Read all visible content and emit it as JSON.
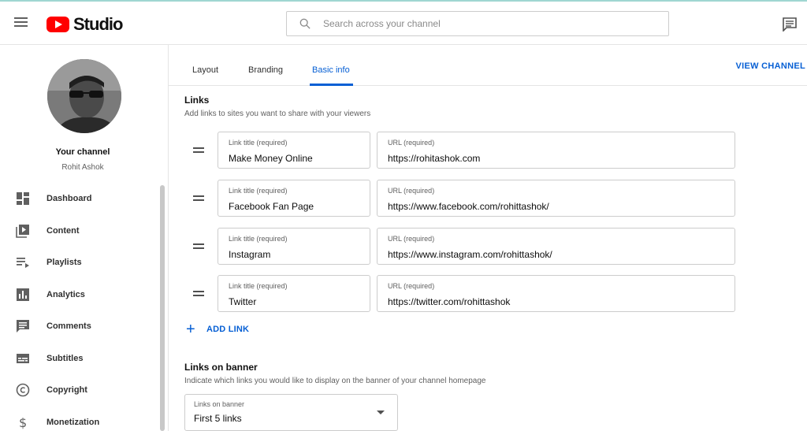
{
  "header": {
    "logo_text": "Studio",
    "search_placeholder": "Search across your channel"
  },
  "sidebar": {
    "channel_title": "Your channel",
    "channel_name": "Rohit Ashok",
    "items": [
      {
        "label": "Dashboard",
        "icon": "dashboard-icon"
      },
      {
        "label": "Content",
        "icon": "content-icon"
      },
      {
        "label": "Playlists",
        "icon": "playlists-icon"
      },
      {
        "label": "Analytics",
        "icon": "analytics-icon"
      },
      {
        "label": "Comments",
        "icon": "comments-icon"
      },
      {
        "label": "Subtitles",
        "icon": "subtitles-icon"
      },
      {
        "label": "Copyright",
        "icon": "copyright-icon"
      },
      {
        "label": "Monetization",
        "icon": "monetization-icon"
      }
    ]
  },
  "tabs": [
    {
      "label": "Layout"
    },
    {
      "label": "Branding"
    },
    {
      "label": "Basic info",
      "active": true
    }
  ],
  "view_channel_label": "VIEW CHANNEL",
  "links_section": {
    "title": "Links",
    "description": "Add links to sites you want to share with your viewers",
    "title_label": "Link title (required)",
    "url_label": "URL (required)",
    "links": [
      {
        "title": "Make Money Online",
        "url": "https://rohitashok.com"
      },
      {
        "title": "Facebook Fan Page",
        "url": "https://www.facebook.com/rohittashok/"
      },
      {
        "title": "Instagram",
        "url": "https://www.instagram.com/rohittashok/"
      },
      {
        "title": "Twitter",
        "url": "https://twitter.com/rohittashok"
      }
    ],
    "add_link_label": "ADD LINK"
  },
  "banner_section": {
    "title": "Links on banner",
    "description": "Indicate which links you would like to display on the banner of your channel homepage",
    "select_label": "Links on banner",
    "select_value": "First 5 links"
  },
  "colors": {
    "accent": "#065fd4",
    "brand": "#ff0000"
  }
}
